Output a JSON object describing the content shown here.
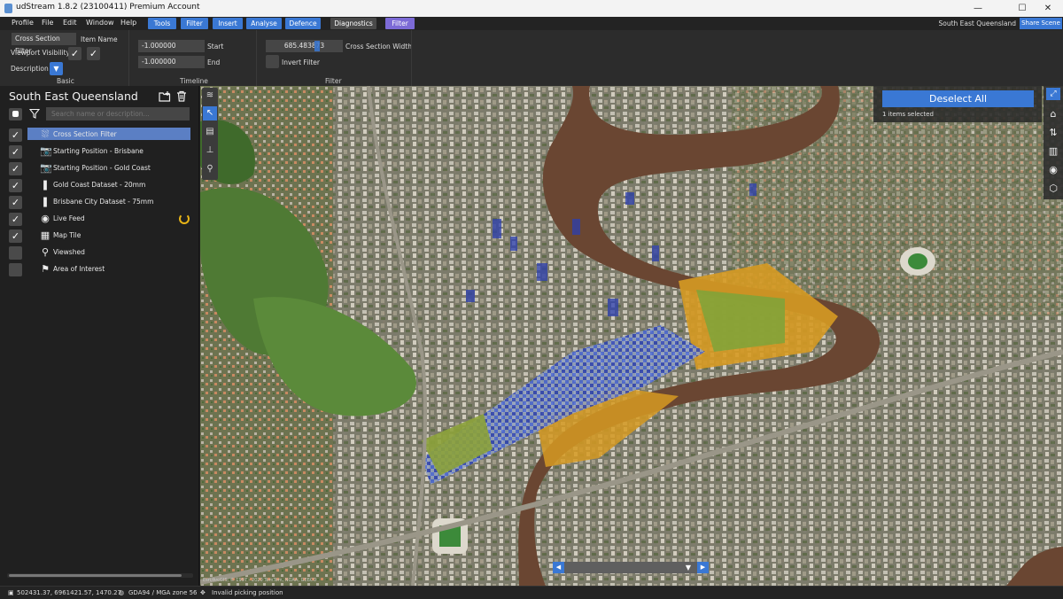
{
  "window": {
    "title": "udStream 1.8.2 (23100411) Premium Account",
    "minimize_glyph": "—",
    "maximize_glyph": "☐",
    "close_glyph": "✕"
  },
  "menu": {
    "items": [
      "Profile",
      "File",
      "Edit",
      "Window",
      "Help"
    ],
    "tabs": [
      "Tools",
      "Filter",
      "Insert",
      "Analyse",
      "Defence",
      "Diagnostics",
      "Filter"
    ],
    "scene_name": "South East Queensland",
    "share_label": "Share Scene"
  },
  "ribbon": {
    "basic": {
      "name_value": "Cross Section Filter",
      "name_label": "Item Name",
      "visibility_label": "Viewport Visibility",
      "description_label": "Description",
      "group_label": "Basic"
    },
    "timeline": {
      "start_value": "-1.000000",
      "start_label": "Start",
      "end_value": "-1.000000",
      "end_label": "End",
      "group_label": "Timeline"
    },
    "filter": {
      "width_value": "685.483873",
      "width_label": "Cross Section Width",
      "invert_label": "Invert Filter",
      "group_label": "Filter"
    }
  },
  "scene_panel": {
    "title": "South East Queensland",
    "search_placeholder": "Search name or description...",
    "items": [
      {
        "label": "Cross Section Filter",
        "checked": true,
        "icon": "cross-section-icon",
        "glyph": "⛆",
        "selected": true
      },
      {
        "label": "Starting Position - Brisbane",
        "checked": true,
        "icon": "camera-icon",
        "glyph": "📷"
      },
      {
        "label": "Starting Position - Gold Coast",
        "checked": true,
        "icon": "camera-icon",
        "glyph": "📷"
      },
      {
        "label": "Gold Coast Dataset - 20mm",
        "checked": true,
        "icon": "pointcloud-icon",
        "glyph": "❚"
      },
      {
        "label": "Brisbane City Dataset - 75mm",
        "checked": true,
        "icon": "pointcloud-icon",
        "glyph": "❚"
      },
      {
        "label": "Live Feed",
        "checked": true,
        "icon": "live-feed-icon",
        "glyph": "◉"
      },
      {
        "label": "Map Tile",
        "checked": true,
        "icon": "map-icon",
        "glyph": "▦"
      },
      {
        "label": "Viewshed",
        "checked": false,
        "icon": "viewshed-icon",
        "glyph": "⚲"
      },
      {
        "label": "Area of Interest",
        "checked": false,
        "icon": "pin-icon",
        "glyph": "⚑"
      }
    ]
  },
  "viewport": {
    "deselect_label": "Deselect All",
    "selected_count": "1 items selected",
    "attribution": "Esri/ArcGIS, © 1997 - 2020 TomTom, NOAA, GEBCO"
  },
  "status": {
    "coordinates": "502431.37, 6961421.57, 1470.27",
    "projection": "GDA94 / MGA zone 56",
    "picking": "Invalid picking position"
  }
}
